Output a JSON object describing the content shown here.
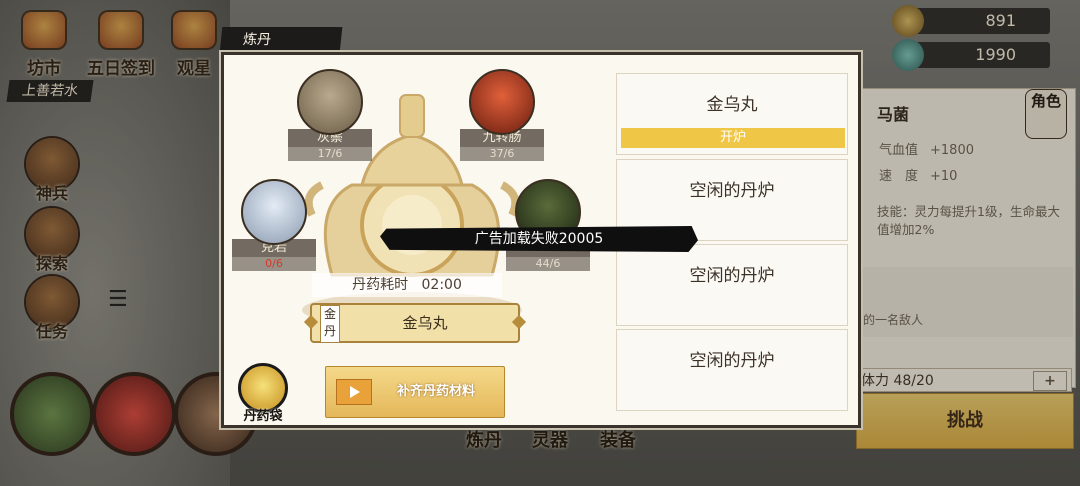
{
  "background": {
    "top_nav": [
      {
        "label": "坊市"
      },
      {
        "label": "五日签到"
      },
      {
        "label": "观星"
      }
    ],
    "location": "上善若水",
    "side_menu": [
      {
        "label": "神兵"
      },
      {
        "label": "探索"
      },
      {
        "label": "任务"
      }
    ],
    "resources": [
      {
        "value": "891",
        "icon": "coin-icon"
      },
      {
        "value": "1990",
        "icon": "jade-icon"
      }
    ],
    "character": {
      "name": "马菌",
      "role_label": "角色",
      "stats": [
        {
          "label": "气血值",
          "value": "+1800"
        },
        {
          "label": "速　度",
          "value": "+10"
        }
      ],
      "skill": "技能：灵力每提升1级，生命最大值增加2%",
      "enemy_text": "的一名敌人"
    },
    "stamina": "体力 48/20",
    "stamina_plus": "+",
    "challenge_label": "挑战",
    "bottom_tabs": [
      "炼丹",
      "灵器",
      "装备"
    ]
  },
  "modal": {
    "title": "炼丹",
    "ingredients": [
      {
        "name": "灰鬃",
        "count": "17/6",
        "insufficient": false
      },
      {
        "name": "九转肠",
        "count": "37/6",
        "insufficient": false
      },
      {
        "name": "克岩",
        "count": "0/6",
        "insufficient": true
      },
      {
        "name": "",
        "count": "44/6",
        "insufficient": false
      }
    ],
    "time_label": "丹药耗时",
    "time_value": "02:00",
    "pill_type": "金丹",
    "pill_name": "金乌丸",
    "pill_bag_label": "丹药袋",
    "refill_label": "补齐丹药材料",
    "slots": [
      {
        "text": "金乌丸",
        "button": "开炉"
      },
      {
        "text": "空闲的丹炉"
      },
      {
        "text": "空闲的丹炉"
      },
      {
        "text": "空闲的丹炉"
      }
    ]
  },
  "toast": "广告加载失败20005"
}
